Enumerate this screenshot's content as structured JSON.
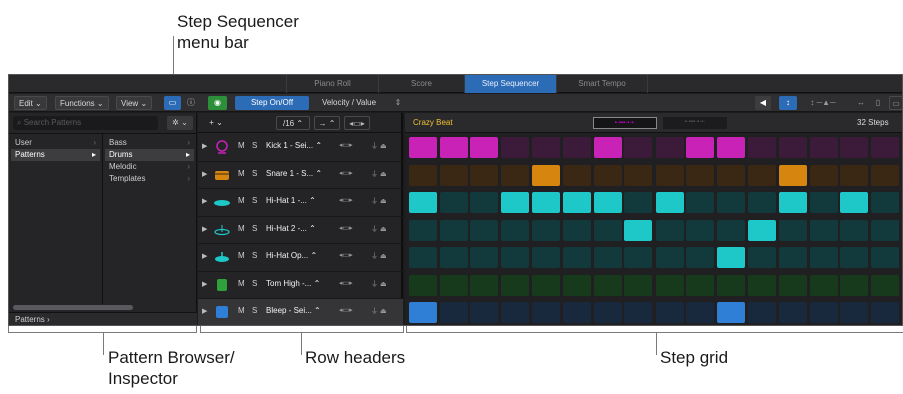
{
  "callouts": {
    "menu_bar_line1": "Step Sequencer",
    "menu_bar_line2": "menu bar",
    "pattern_browser_line1": "Pattern Browser/",
    "pattern_browser_line2": "Inspector",
    "row_headers": "Row headers",
    "step_grid": "Step grid"
  },
  "tabs": [
    "Piano Roll",
    "Score",
    "Step Sequencer",
    "Smart Tempo"
  ],
  "active_tab": "Step Sequencer",
  "menubar": {
    "edit": "Edit",
    "functions": "Functions",
    "view": "View",
    "step_on_off": "Step On/Off",
    "velocity_value": "Velocity / Value"
  },
  "browser": {
    "search_placeholder": "Search Patterns",
    "left_items": [
      "User",
      "Patterns"
    ],
    "right_items": [
      "Bass",
      "Drums",
      "Melodic",
      "Templates"
    ],
    "footer": "Patterns  ›"
  },
  "row_header_toolbar": {
    "add": "+ ⌄",
    "division": "/16 ⌃",
    "direction": "→ ⌃"
  },
  "grid_header": {
    "pattern_name": "Crazy Beat",
    "steps_label": "32 Steps"
  },
  "rows": [
    {
      "name": "Kick 1 - Sei...",
      "icon": "kick-drum-icon",
      "color": "#c822b6",
      "dim": "#3b1a3a",
      "steps": [
        1,
        1,
        1,
        0,
        0,
        0,
        1,
        0,
        0,
        1,
        1,
        0,
        0,
        0,
        0,
        0
      ]
    },
    {
      "name": "Snare 1 - S...",
      "icon": "snare-drum-icon",
      "color": "#d6860f",
      "dim": "#3b2814",
      "steps": [
        0,
        0,
        0,
        0,
        1,
        0,
        0,
        0,
        0,
        0,
        0,
        0,
        1,
        0,
        0,
        0
      ]
    },
    {
      "name": "Hi-Hat 1 -...",
      "icon": "hihat-closed-icon",
      "color": "#1ec8c8",
      "dim": "#12393b",
      "steps": [
        1,
        0,
        0,
        1,
        1,
        1,
        1,
        0,
        1,
        0,
        0,
        0,
        1,
        0,
        1,
        0
      ]
    },
    {
      "name": "Hi-Hat 2 -...",
      "icon": "hihat-pedal-icon",
      "color": "#1ec8c8",
      "dim": "#12393b",
      "steps": [
        0,
        0,
        0,
        0,
        0,
        0,
        0,
        1,
        0,
        0,
        0,
        1,
        0,
        0,
        0,
        0
      ]
    },
    {
      "name": "Hi-Hat Op...",
      "icon": "hihat-open-icon",
      "color": "#1ec8c8",
      "dim": "#12393b",
      "steps": [
        0,
        0,
        0,
        0,
        0,
        0,
        0,
        0,
        0,
        0,
        1,
        0,
        0,
        0,
        0,
        0
      ]
    },
    {
      "name": "Tom High -...",
      "icon": "tom-drum-icon",
      "color": "#2fa03a",
      "dim": "#183a1c",
      "steps": [
        0,
        0,
        0,
        0,
        0,
        0,
        0,
        0,
        0,
        0,
        0,
        0,
        0,
        0,
        0,
        0
      ]
    },
    {
      "name": "Bleep - Sei...",
      "icon": "bleep-instrument-icon",
      "color": "#2f7fd6",
      "dim": "#18283d",
      "steps": [
        1,
        0,
        0,
        0,
        0,
        0,
        0,
        0,
        0,
        0,
        1,
        0,
        0,
        0,
        0,
        0
      ]
    }
  ],
  "row_labels": {
    "mute": "M",
    "solo": "S"
  }
}
